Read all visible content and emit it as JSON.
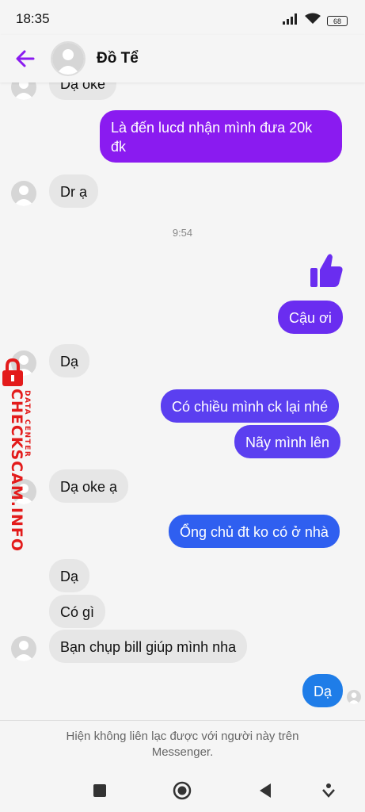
{
  "status_bar": {
    "time": "18:35",
    "battery": "68"
  },
  "header": {
    "contact_name": "Đồ Tể"
  },
  "messages": [
    {
      "text": "Dạ oke"
    },
    {
      "line1": "Là đến lucd nhận mình đưa 20k",
      "line2": "đk"
    },
    {
      "text": "Dr ạ"
    },
    {
      "timestamp": "9:54"
    },
    {
      "text": "Cậu ơi"
    },
    {
      "text": "Dạ"
    },
    {
      "text": "Có chiều mình ck lại nhé"
    },
    {
      "text": "Nãy mình lên"
    },
    {
      "text": "Dạ oke ạ"
    },
    {
      "text": "Ổng chủ đt ko có ở nhà"
    },
    {
      "text": "Dạ"
    },
    {
      "text": "Có gì"
    },
    {
      "text": "Bạn chụp bill giúp mình nha"
    },
    {
      "text": "Dạ"
    }
  ],
  "watermark": {
    "brand": "CHECKSCAM.INFO",
    "sub": "DATA CENTER"
  },
  "footer": {
    "notice": "Hiện không liên lạc được với người này trên Messenger."
  },
  "colors": {
    "outgoing_top": "#8a1bf0",
    "outgoing_mid": "#5b3ff0",
    "outgoing_bottom": "#1f7de8",
    "accent": "#8a1bf0"
  }
}
